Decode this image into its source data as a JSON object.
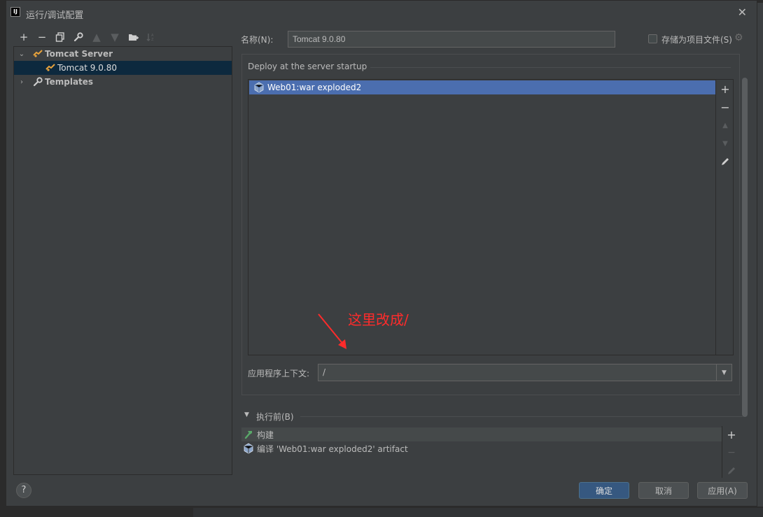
{
  "window": {
    "title": "运行/调试配置",
    "app_icon": "IJ"
  },
  "tree": {
    "items": [
      {
        "label": "Tomcat Server"
      },
      {
        "label": "Tomcat 9.0.80"
      },
      {
        "label": "Templates"
      }
    ]
  },
  "form": {
    "name_label": "名称(N):",
    "name_value": "Tomcat 9.0.80",
    "store_label": "存储为项目文件(S)"
  },
  "deploy": {
    "section_title": "Deploy at the server startup",
    "items": [
      "Web01:war exploded2"
    ]
  },
  "annotation": {
    "text": "这里改成/"
  },
  "context": {
    "label": "应用程序上下文:",
    "value": "/"
  },
  "before_launch": {
    "title": "执行前(B)",
    "items": [
      "构建",
      "编译 'Web01:war exploded2' artifact"
    ]
  },
  "buttons": {
    "help": "?",
    "ok": "确定",
    "cancel": "取消",
    "apply": "应用(A)"
  },
  "colors": {
    "accent": "#365880",
    "selection": "#4b6eaf",
    "annotation": "#ff2b2b",
    "background": "#3c3f41"
  }
}
